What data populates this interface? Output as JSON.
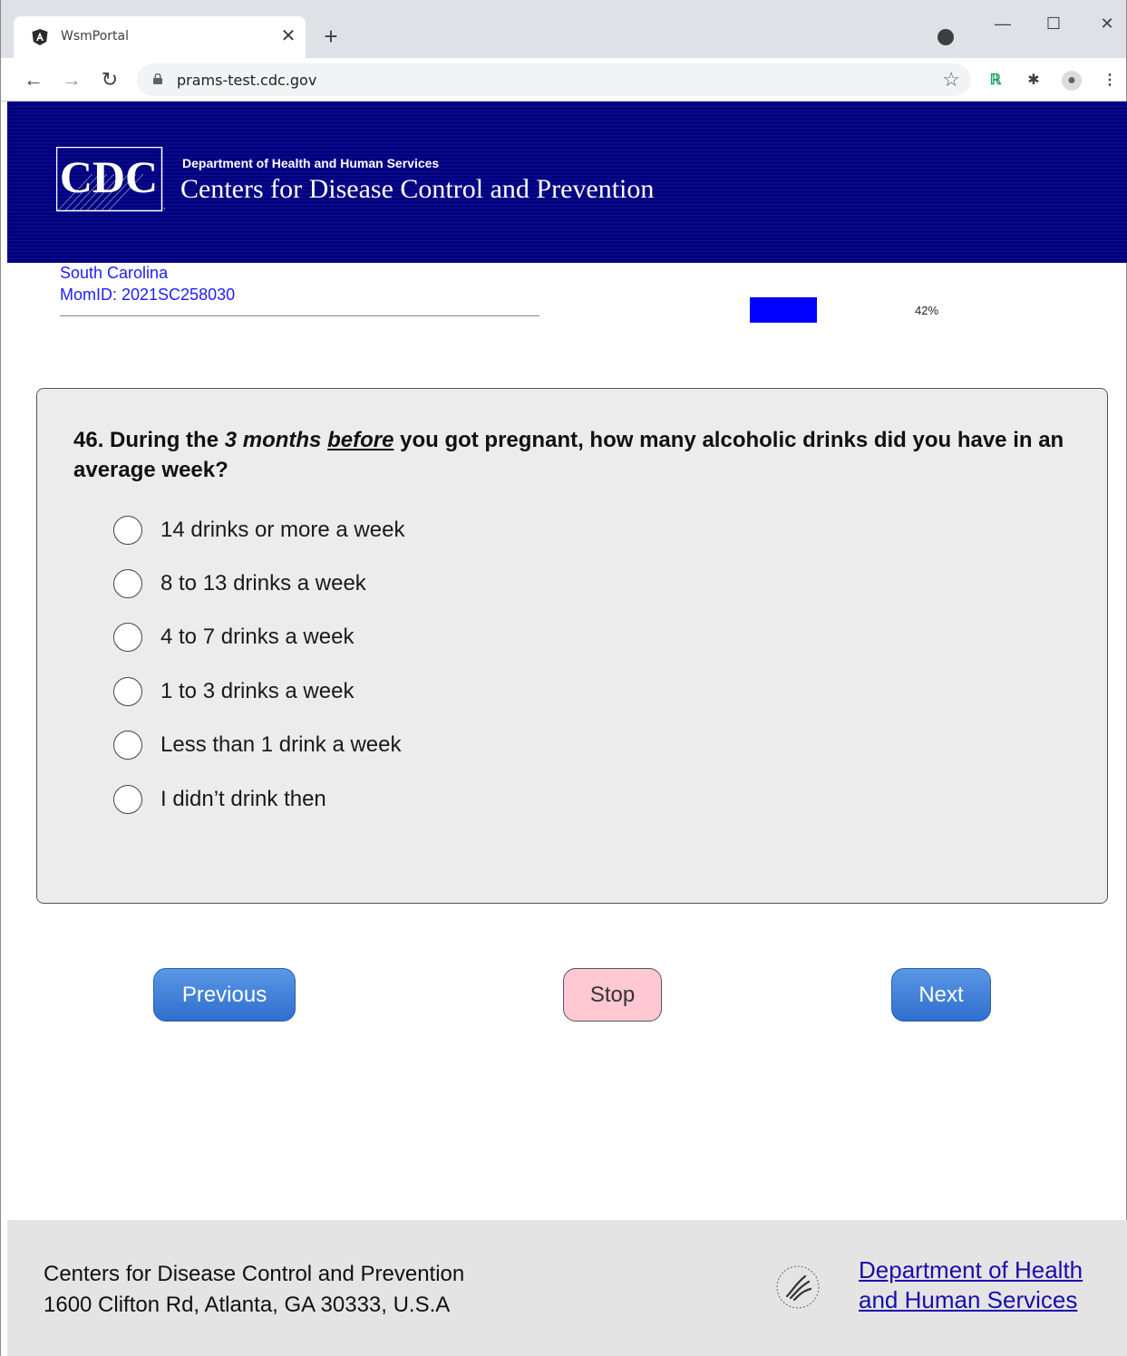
{
  "browser": {
    "tab_title": "WsmPortal",
    "url": "prams-test.cdc.gov"
  },
  "banner": {
    "logo_text": "CDC",
    "department": "Department of Health and Human Services",
    "agency": "Centers for Disease Control and Prevention"
  },
  "respondent": {
    "state": "South Carolina",
    "mom_id": "MomID: 2021SC258030"
  },
  "progress": {
    "value": 0.42,
    "label": "42%",
    "fill_color": "#0000ff"
  },
  "question": {
    "number": "46.",
    "text_before": "During the",
    "emph_1": "3 months",
    "emph_2": "before",
    "text_after": "you got pregnant, how many alcoholic drinks did you have in an average week?",
    "options": [
      "14 drinks or more a week",
      "8 to 13 drinks a week",
      "4 to 7 drinks a week",
      "1 to 3 drinks a week",
      "Less than 1 drink a week",
      "I didn’t drink then"
    ]
  },
  "buttons": {
    "previous": "Previous",
    "stop": "Stop",
    "next": "Next"
  },
  "footer": {
    "org": "Centers for Disease Control and Prevention",
    "address": "1600 Clifton Rd, Atlanta, GA 30333, U.S.A",
    "hhs_link_line1": "Department of Health",
    "hhs_link_line2": "and Human Services"
  },
  "colors": {
    "banner": "#000080",
    "link": "#1a0dab",
    "respondent_text": "#1e1eff",
    "stop_button": "#ffc8d2",
    "nav_button": "#2f6fce"
  }
}
